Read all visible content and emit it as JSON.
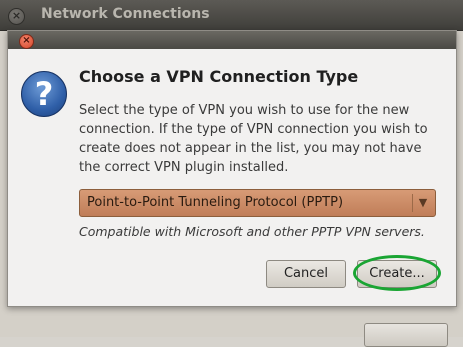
{
  "background_window": {
    "title": "Network Connections",
    "close_glyph": "×"
  },
  "dialog": {
    "close_glyph": "×",
    "icon": "question-icon",
    "icon_glyph": "?",
    "heading": "Choose a VPN Connection Type",
    "description": "Select the type of VPN you wish to use for the new connection.  If the type of VPN connection you wish to create does not appear in the list, you may not have the correct VPN plugin installed.",
    "vpn_type": {
      "selected": "Point-to-Point Tunneling Protocol (PPTP)",
      "arrow_glyph": "▼"
    },
    "hint": "Compatible with Microsoft and other PPTP VPN servers.",
    "buttons": {
      "cancel": "Cancel",
      "create": "Create..."
    }
  },
  "colors": {
    "highlight": "#1aa533",
    "combo": "#c98763",
    "close_red": "#d4472b"
  }
}
